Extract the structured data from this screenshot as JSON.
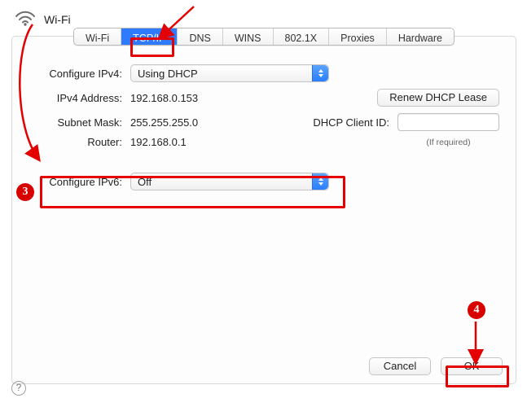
{
  "header": {
    "title": "Wi-Fi"
  },
  "tabs": [
    "Wi-Fi",
    "TCP/IP",
    "DNS",
    "WINS",
    "802.1X",
    "Proxies",
    "Hardware"
  ],
  "activeTab": "TCP/IP",
  "ipv4": {
    "configure_label": "Configure IPv4:",
    "configure_value": "Using DHCP",
    "address_label": "IPv4 Address:",
    "address_value": "192.168.0.153",
    "subnet_label": "Subnet Mask:",
    "subnet_value": "255.255.255.0",
    "router_label": "Router:",
    "router_value": "192.168.0.1",
    "renew_label": "Renew DHCP Lease",
    "clientid_label": "DHCP Client ID:",
    "clientid_value": "",
    "clientid_hint": "(If required)"
  },
  "ipv6": {
    "configure_label": "Configure IPv6:",
    "configure_value": "Off"
  },
  "buttons": {
    "cancel": "Cancel",
    "ok": "OK",
    "help": "?"
  },
  "annotations": {
    "step3": "3",
    "step4": "4"
  }
}
